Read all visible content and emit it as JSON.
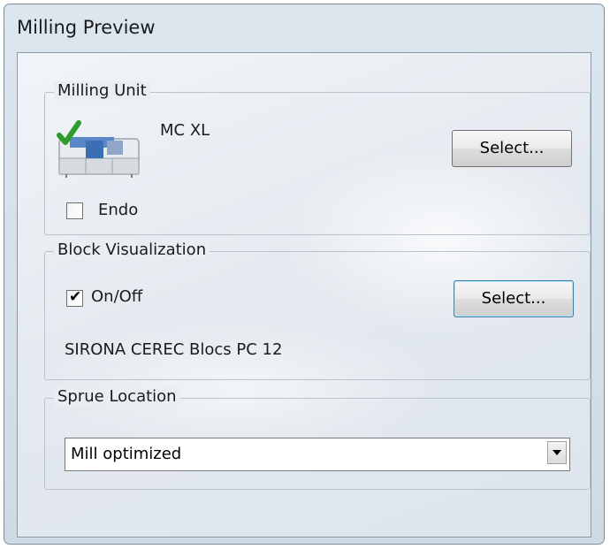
{
  "window": {
    "title": "Milling Preview"
  },
  "milling_unit": {
    "group_label": "Milling Unit",
    "unit_name": "MC XL",
    "select_label": "Select...",
    "endo_label": "Endo",
    "endo_checked": false
  },
  "block_visualization": {
    "group_label": "Block Visualization",
    "toggle_label": "On/Off",
    "toggle_checked": true,
    "select_label": "Select...",
    "block_name": "SIRONA CEREC Blocs PC 12"
  },
  "sprue_location": {
    "group_label": "Sprue Location",
    "selected_value": "Mill optimized"
  },
  "colors": {
    "check_green": "#2e9b2e",
    "unit_blue": "#3d6db3"
  }
}
